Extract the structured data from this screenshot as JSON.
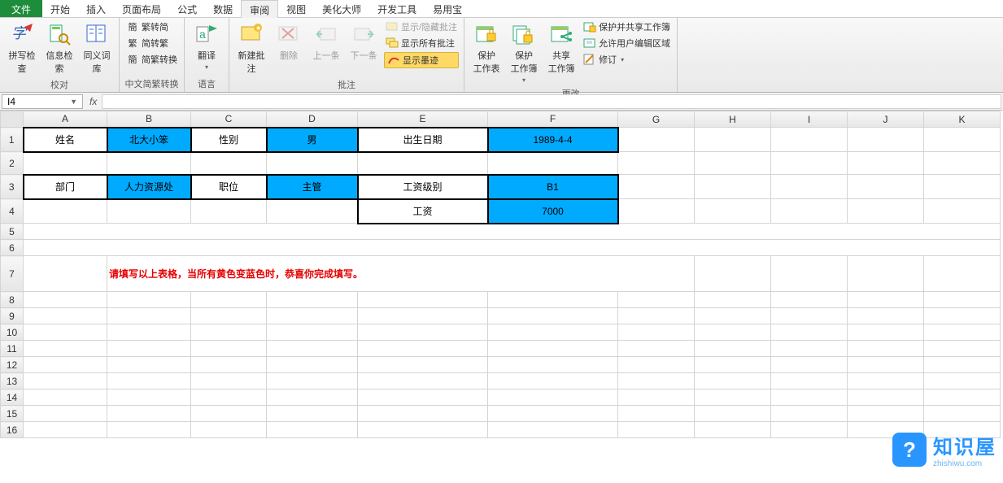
{
  "tabs": {
    "file": "文件",
    "items": [
      "开始",
      "插入",
      "页面布局",
      "公式",
      "数据",
      "审阅",
      "视图",
      "美化大师",
      "开发工具",
      "易用宝"
    ],
    "activeIndex": 5
  },
  "ribbon": {
    "proof": {
      "label": "校对",
      "spellcheck": "拼写检查",
      "research": "信息检索",
      "thesaurus": "同义词库"
    },
    "chinese": {
      "label": "中文简繁转换",
      "t2s": "繁转简",
      "s2t": "简转繁",
      "toggle": "简繁转换"
    },
    "language": {
      "label": "语言",
      "translate": "翻译"
    },
    "comments": {
      "label": "批注",
      "new": "新建批注",
      "delete": "删除",
      "prev": "上一条",
      "next": "下一条",
      "showhide": "显示/隐藏批注",
      "showall": "显示所有批注",
      "ink": "显示墨迹"
    },
    "changes": {
      "label": "更改",
      "protectSheet": "保护\n工作表",
      "protectBook": "保护\n工作簿",
      "share": "共享\n工作簿",
      "protectShare": "保护并共享工作簿",
      "allowEdit": "允许用户编辑区域",
      "track": "修订"
    }
  },
  "namebox": "I4",
  "fx_label": "fx",
  "cols": [
    "A",
    "B",
    "C",
    "D",
    "E",
    "F",
    "G",
    "H",
    "I",
    "J",
    "K"
  ],
  "rows": [
    "1",
    "2",
    "3",
    "4",
    "5",
    "6",
    "7",
    "8",
    "9",
    "10",
    "11",
    "12",
    "13",
    "14",
    "15",
    "16"
  ],
  "cells": {
    "A1": "姓名",
    "B1": "北大小笨",
    "C1": "性别",
    "D1": "男",
    "E1": "出生日期",
    "F1": "1989-4-4",
    "A3": "部门",
    "B3": "人力资源处",
    "C3": "职位",
    "D3": "主管",
    "E3": "工资级别",
    "F3": "B1",
    "E4": "工资",
    "F4": "7000"
  },
  "note": "请填写以上表格，当所有黄色变蓝色时，恭喜你完成填写。",
  "logo": {
    "cn": "知识屋",
    "en": "zhishiwu.com",
    "mark": "?"
  }
}
